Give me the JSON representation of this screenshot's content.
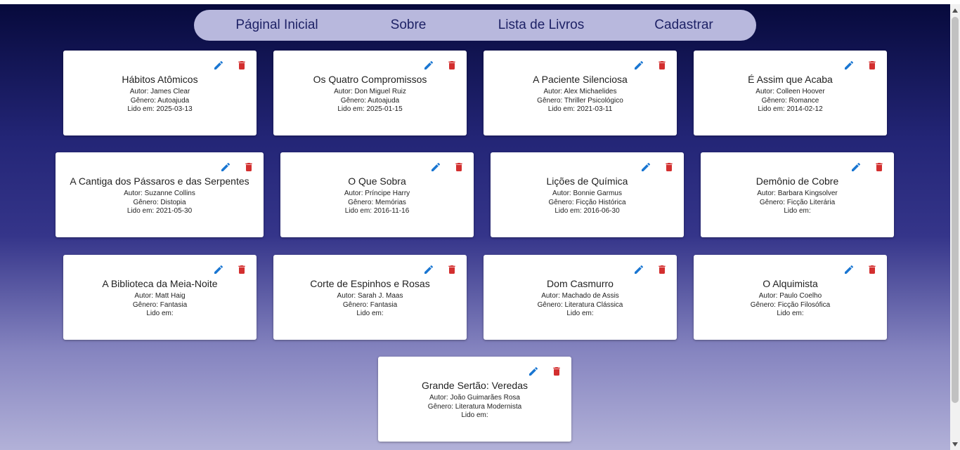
{
  "nav": {
    "items": [
      {
        "label": "Páginal Inicial"
      },
      {
        "label": "Sobre"
      },
      {
        "label": "Lista de Livros"
      },
      {
        "label": "Cadastrar"
      }
    ]
  },
  "icons": {
    "edit": "pencil-icon",
    "delete": "trash-icon",
    "edit_color": "#1976d2",
    "delete_color": "#d32f2f"
  },
  "books": [
    {
      "title": "Hábitos Atômicos",
      "author": "Autor: James Clear",
      "genre": "Gênero: Autoajuda",
      "read": "Lido em: 2025-03-13"
    },
    {
      "title": "Os Quatro Compromissos",
      "author": "Autor: Don Miguel Ruiz",
      "genre": "Gênero: Autoajuda",
      "read": "Lido em: 2025-01-15"
    },
    {
      "title": "A Paciente Silenciosa",
      "author": "Autor: Alex Michaelides",
      "genre": "Gênero: Thriller Psicológico",
      "read": "Lido em: 2021-03-11"
    },
    {
      "title": "É Assim que Acaba",
      "author": "Autor: Colleen Hoover",
      "genre": "Gênero: Romance",
      "read": "Lido em: 2014-02-12"
    },
    {
      "title": "A Cantiga dos Pássaros e das Serpentes",
      "author": "Autor: Suzanne Collins",
      "genre": "Gênero: Distopia",
      "read": "Lido em: 2021-05-30"
    },
    {
      "title": "O Que Sobra",
      "author": "Autor: Príncipe Harry",
      "genre": "Gênero: Memórias",
      "read": "Lido em: 2016-11-16"
    },
    {
      "title": "Lições de Química",
      "author": "Autor: Bonnie Garmus",
      "genre": "Gênero: Ficção Histórica",
      "read": "Lido em: 2016-06-30"
    },
    {
      "title": "Demônio de Cobre",
      "author": "Autor: Barbara Kingsolver",
      "genre": "Gênero: Ficção Literária",
      "read": "Lido em:"
    },
    {
      "title": "A Biblioteca da Meia-Noite",
      "author": "Autor: Matt Haig",
      "genre": "Gênero: Fantasia",
      "read": "Lido em:"
    },
    {
      "title": "Corte de Espinhos e Rosas",
      "author": "Autor: Sarah J. Maas",
      "genre": "Gênero: Fantasia",
      "read": "Lido em:"
    },
    {
      "title": "Dom Casmurro",
      "author": "Autor: Machado de Assis",
      "genre": "Gênero: Literatura Clássica",
      "read": "Lido em:"
    },
    {
      "title": "O Alquimista",
      "author": "Autor: Paulo Coelho",
      "genre": "Gênero: Ficção Filosófica",
      "read": "Lido em:"
    },
    {
      "title": "Grande Sertão: Veredas",
      "author": "Autor: João Guimarães Rosa",
      "genre": "Gênero: Literatura Modernista",
      "read": "Lido em:"
    }
  ]
}
